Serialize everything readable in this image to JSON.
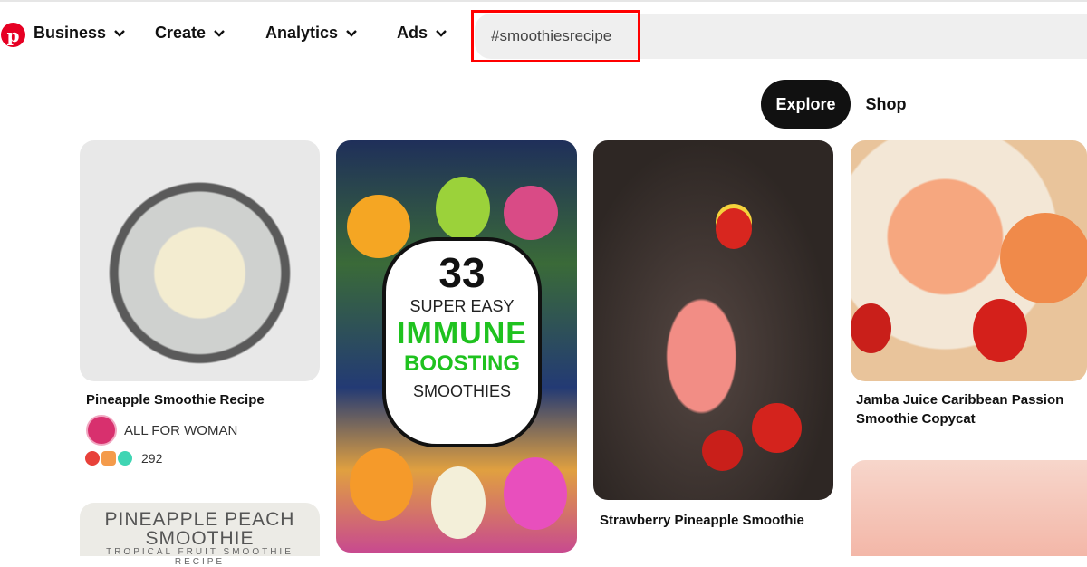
{
  "nav": {
    "logo": "pinterest-logo",
    "items": [
      {
        "label": "Business",
        "icon": "chevron-down-icon"
      },
      {
        "label": "Create",
        "icon": "chevron-down-icon"
      },
      {
        "label": "Analytics",
        "icon": "chevron-down-icon"
      },
      {
        "label": "Ads",
        "icon": "chevron-down-icon"
      }
    ],
    "search": {
      "value": "#smoothiesrecipe"
    }
  },
  "tabs": [
    {
      "label": "Explore",
      "active": true
    },
    {
      "label": "Shop",
      "active": false
    }
  ],
  "pins": [
    {
      "title": "Pineapple Smoothie Recipe",
      "author": "ALL FOR WOMAN",
      "reactions": [
        "heart",
        "wow",
        "star"
      ],
      "reaction_count": "292"
    },
    {
      "title": "",
      "image_text": {
        "number": "33",
        "line1": "SUPER EASY",
        "line2": "IMMUNE",
        "line3": "BOOSTING",
        "line4": "SMOOTHIES"
      }
    },
    {
      "title": "Strawberry Pineapple Smoothie"
    },
    {
      "title": "Jamba Juice Caribbean Passion Smoothie Copycat"
    },
    {
      "title": "",
      "image_text": {
        "line1": "PINEAPPLE PEACH",
        "line2": "SMOOTHIE",
        "line3": "TROPICAL FRUIT SMOOTHIE RECIPE"
      }
    },
    {
      "title": ""
    }
  ],
  "colors": {
    "brand": "#e60023",
    "highlight": "#ff0000",
    "active_tab": "#111111"
  }
}
